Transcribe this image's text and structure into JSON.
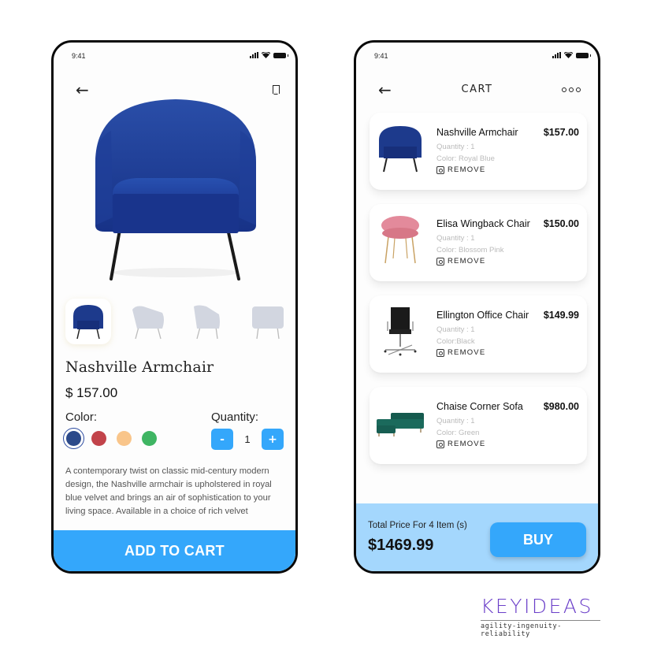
{
  "product_screen": {
    "status_time": "9:41",
    "product_name": "Nashville Armchair",
    "price": "$ 157.00",
    "color_label": "Color:",
    "quantity_label": "Quantity:",
    "quantity_value": "1",
    "minus_label": "-",
    "plus_label": "+",
    "colors": [
      {
        "name": "royal-blue",
        "hex": "#2c4a8a",
        "selected": true
      },
      {
        "name": "red",
        "hex": "#c2434a",
        "selected": false
      },
      {
        "name": "peach",
        "hex": "#f9c58a",
        "selected": false
      },
      {
        "name": "green",
        "hex": "#3fb563",
        "selected": false
      }
    ],
    "thumbnails": [
      "royal-blue-front",
      "grey-side",
      "grey-angle",
      "grey-back",
      "grey-partial"
    ],
    "description": "A contemporary twist on classic mid-century modern design, the Nashville armchair is upholstered in royal blue velvet and brings an air of sophistication to your living space. Available in a choice of rich velvet",
    "add_to_cart_label": "ADD TO CART",
    "back_icon": "arrow-left-icon",
    "bookmark_icon": "bookmark-icon"
  },
  "cart_screen": {
    "status_time": "9:41",
    "title": "CART",
    "more_icon": "more-horizontal-icon",
    "items": [
      {
        "name": "Nashville Armchair",
        "price": "$157.00",
        "quantity": "Quantity : 1",
        "color": "Color: Royal Blue",
        "remove": "REMOVE",
        "image": "blue-armchair"
      },
      {
        "name": "Elisa Wingback Chair",
        "price": "$150.00",
        "quantity": "Quantity : 1",
        "color": "Color: Blossom Pink",
        "remove": "REMOVE",
        "image": "pink-chair"
      },
      {
        "name": "Ellington Office Chair",
        "price": "$149.99",
        "quantity": "Quantity : 1",
        "color": "Color:Black",
        "remove": "REMOVE",
        "image": "black-office-chair"
      },
      {
        "name": "Chaise Corner Sofa",
        "price": "$980.00",
        "quantity": "Quantity : 1",
        "color": "Color: Green",
        "remove": "REMOVE",
        "image": "green-sofa"
      }
    ],
    "total_label": "Total Price For 4 Item (s)",
    "total_value": "$1469.99",
    "buy_label": "BUY"
  },
  "brand": {
    "name": "KEYIDEAS",
    "tagline": "agility-ingenuity-reliability"
  },
  "colors": {
    "accent": "#34a7fb",
    "footer_bg": "#a4d7fd",
    "brand_purple": "#6b3fc9",
    "chair_blue": "#1d3a8c"
  }
}
